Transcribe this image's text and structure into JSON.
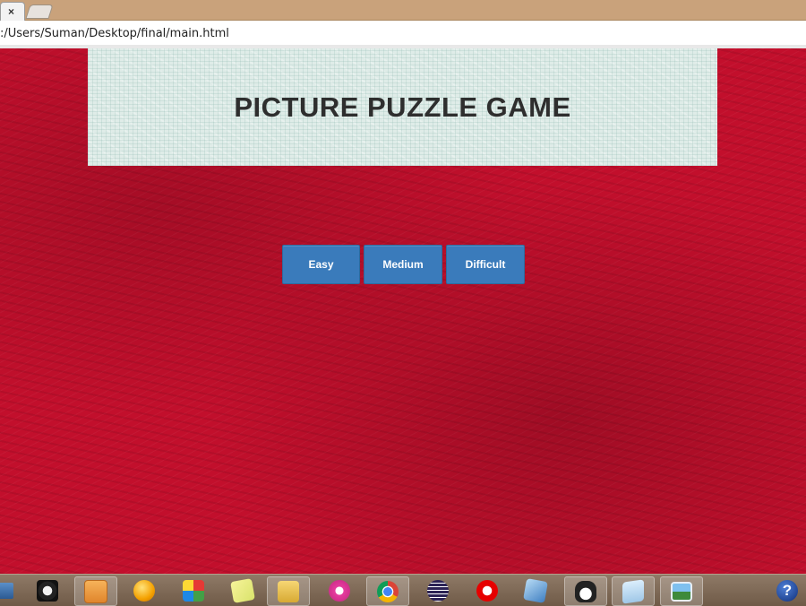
{
  "browser": {
    "tab_close": "×",
    "address_url": ":/Users/Suman/Desktop/final/main.html"
  },
  "page": {
    "title": "PICTURE PUZZLE GAME",
    "buttons": {
      "easy": "Easy",
      "medium": "Medium",
      "difficult": "Difficult"
    }
  },
  "taskbar": {
    "items": [
      {
        "name": "monitor-icon"
      },
      {
        "name": "webcam-icon"
      },
      {
        "name": "media-player-icon"
      },
      {
        "name": "orange-globe-icon"
      },
      {
        "name": "puzzle-app-icon"
      },
      {
        "name": "sticky-notes-icon"
      },
      {
        "name": "file-explorer-icon"
      },
      {
        "name": "pink-app-icon"
      },
      {
        "name": "chrome-icon"
      },
      {
        "name": "eclipse-icon"
      },
      {
        "name": "vodafone-icon"
      },
      {
        "name": "virtualbox-icon"
      },
      {
        "name": "penguin-app-icon"
      },
      {
        "name": "notepad-icon"
      },
      {
        "name": "picture-viewer-icon"
      },
      {
        "name": "help-icon"
      }
    ],
    "help_label": "?"
  },
  "colors": {
    "background_red": "#c20f2c",
    "header_bg": "#dfece8",
    "button_blue": "#3a7bbb"
  }
}
